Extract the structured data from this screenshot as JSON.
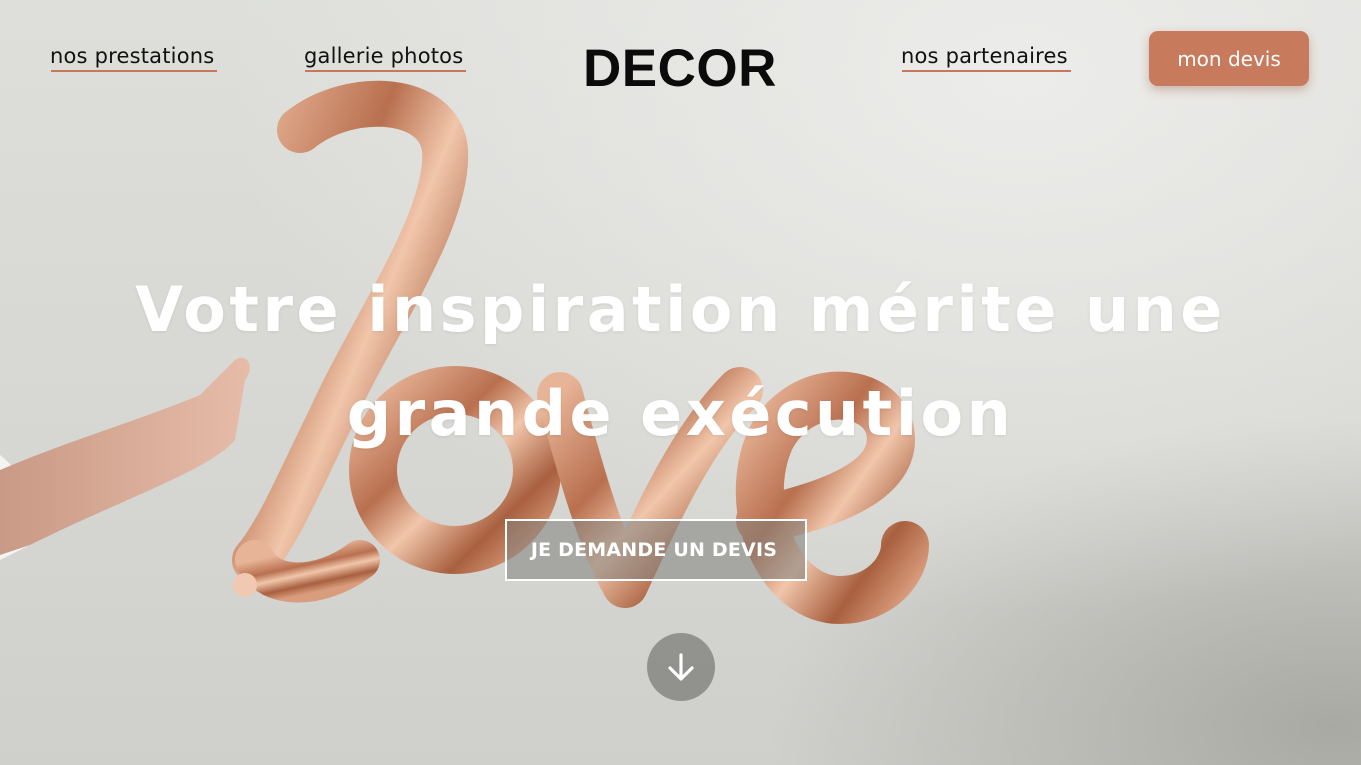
{
  "brand": {
    "logo_text": "DECOR"
  },
  "nav": {
    "items": [
      {
        "label": "nos prestations"
      },
      {
        "label": "gallerie photos"
      },
      {
        "label": "nos partenaires"
      }
    ],
    "cta_label": "mon devis"
  },
  "hero": {
    "headline_line1": "Votre inspiration mérite une",
    "headline_line2": "grande exécution",
    "cta_label": "JE DEMANDE UN DEVIS",
    "balloon_word": "love",
    "scroll_icon": "arrow-down-icon"
  },
  "colors": {
    "accent": "#c87b5c",
    "underline": "#c7775a",
    "balloon": "#c98a6a",
    "text_dark": "#0b0b0b",
    "text_light": "#ffffff"
  }
}
